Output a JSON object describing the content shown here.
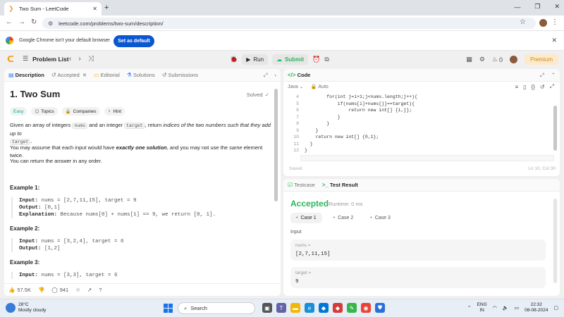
{
  "browser": {
    "tab_title": "Two Sum - LeetCode",
    "url": "leetcode.com/problems/two-sum/description/",
    "info_message": "Google Chrome isn't your default browser",
    "set_default_label": "Set as default"
  },
  "header": {
    "problem_list": "Problem List",
    "run": "Run",
    "submit": "Submit",
    "streak": "0",
    "premium": "Premium"
  },
  "left_tabs": [
    "Description",
    "Accepted",
    "Editorial",
    "Solutions",
    "Submissions"
  ],
  "problem": {
    "title": "1. Two Sum",
    "solved": "Solved",
    "tags": [
      "Easy",
      "Topics",
      "Companies",
      "Hint"
    ],
    "p1a": "Given an array of integers ",
    "p1_code1": "nums",
    "p1b": " and an integer ",
    "p1_code2": "target",
    "p1c": ", return ",
    "p1_italic": "indices of the two numbers such that they add up to",
    "p1_code3": "target",
    "p1d": ".",
    "p2a": "You may assume that each input would have ",
    "p2_bold": "exactly one solution",
    "p2b": ", and you may not use the ",
    "p2_italic": "same",
    "p2c": " element twice.",
    "p3": "You can return the answer in any order.",
    "examples": [
      {
        "title": "Example 1:",
        "input_label": "Input:",
        "input": " nums = [2,7,11,15], target = 9",
        "output_label": "Output:",
        "output": " [0,1]",
        "explanation_label": "Explanation:",
        "explanation": " Because nums[0] + nums[1] == 9, we return [0, 1]."
      },
      {
        "title": "Example 2:",
        "input_label": "Input:",
        "input": " nums = [3,2,4], target = 6",
        "output_label": "Output:",
        "output": " [1,2]"
      },
      {
        "title": "Example 3:",
        "input_label": "Input:",
        "input": " nums = [3,3], target = 6"
      }
    ]
  },
  "footer": {
    "likes": "57.5K",
    "comments": "941"
  },
  "code": {
    "title": "Code",
    "language": "Java",
    "mode": "Auto",
    "lines": [
      {
        "n": "4",
        "text": "        for(int j=i+1;j<nums.length;j++){"
      },
      {
        "n": "5",
        "text": "            if(nums[i]+nums[j]==target){"
      },
      {
        "n": "6",
        "text": "                return new int[] {i,j};"
      },
      {
        "n": "7",
        "text": "            }"
      },
      {
        "n": "8",
        "text": "        }"
      },
      {
        "n": "9",
        "text": "    }"
      },
      {
        "n": "10",
        "text": "    return new int[] {0,1};"
      },
      {
        "n": "11",
        "text": "  }"
      },
      {
        "n": "12",
        "text": "}"
      }
    ],
    "saved": "Saved",
    "cursor": "Ln 10, Col 30"
  },
  "test": {
    "tab_testcase": "Testcase",
    "tab_result": "Test Result",
    "status": "Accepted",
    "runtime": "Runtime: 0 ms",
    "cases": [
      "Case 1",
      "Case 2",
      "Case 3"
    ],
    "input_label": "Input",
    "inputs": [
      {
        "key": "nums =",
        "value": "[2,7,11,15]"
      },
      {
        "key": "target =",
        "value": "9"
      }
    ]
  },
  "taskbar": {
    "temp": "28°C",
    "weather": "Mostly cloudy",
    "search": "Search",
    "lang1": "ENG",
    "lang2": "IN",
    "time": "22:32",
    "date": "08-08-2024"
  }
}
